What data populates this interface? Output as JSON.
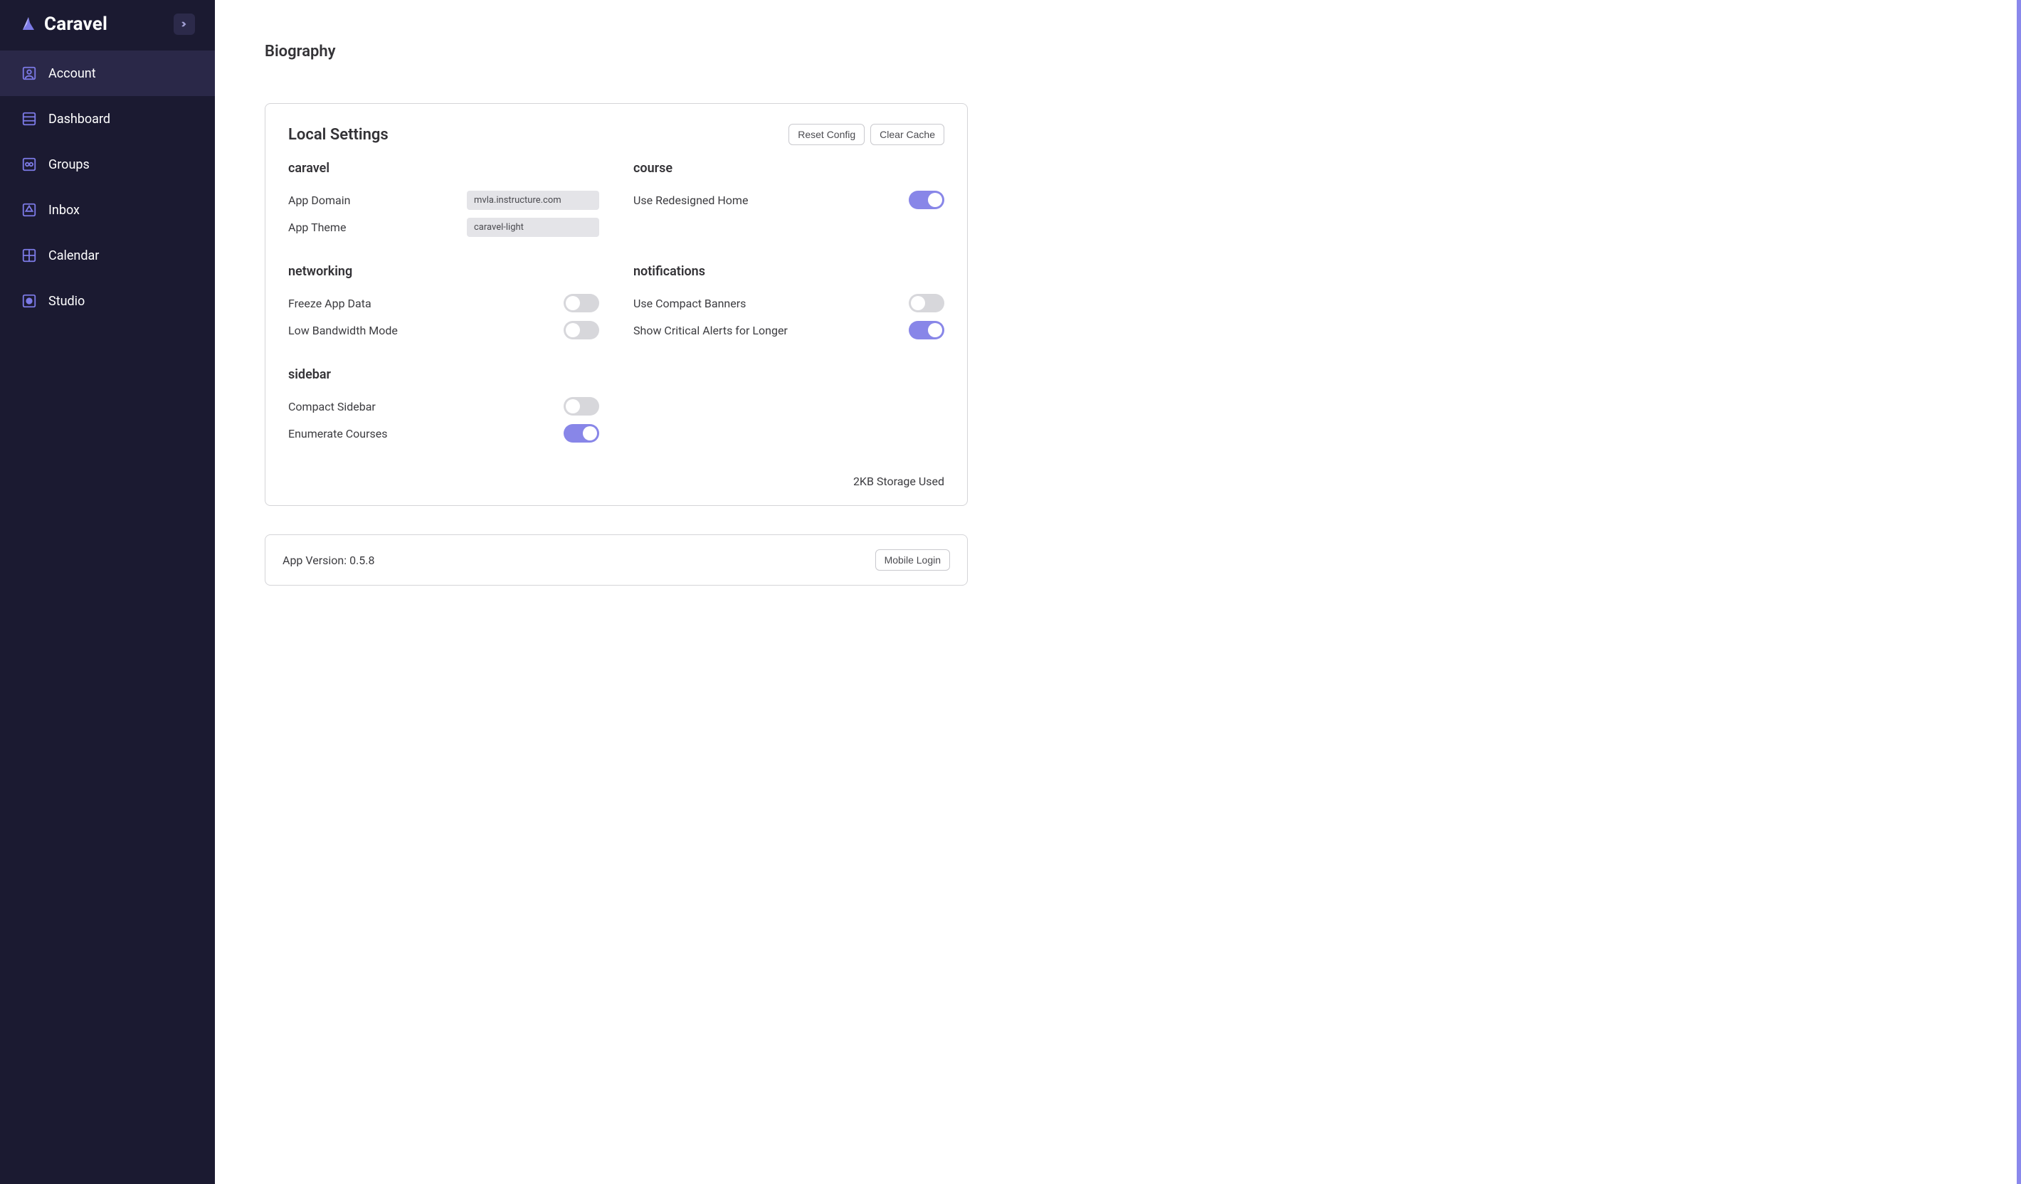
{
  "brand": {
    "name": "Caravel"
  },
  "sidebar": {
    "items": [
      {
        "label": "Account",
        "icon": "account",
        "active": true
      },
      {
        "label": "Dashboard",
        "icon": "dashboard",
        "active": false
      },
      {
        "label": "Groups",
        "icon": "groups",
        "active": false
      },
      {
        "label": "Inbox",
        "icon": "inbox",
        "active": false
      },
      {
        "label": "Calendar",
        "icon": "calendar",
        "active": false
      },
      {
        "label": "Studio",
        "icon": "studio",
        "active": false
      }
    ]
  },
  "page": {
    "biography_heading": "Biography",
    "local_settings": {
      "title": "Local Settings",
      "reset_label": "Reset Config",
      "clear_label": "Clear Cache",
      "caravel": {
        "heading": "caravel",
        "app_domain_label": "App Domain",
        "app_domain_value": "mvla.instructure.com",
        "app_theme_label": "App Theme",
        "app_theme_value": "caravel-light"
      },
      "course": {
        "heading": "course",
        "redesigned_home_label": "Use Redesigned Home",
        "redesigned_home_on": true
      },
      "networking": {
        "heading": "networking",
        "freeze_label": "Freeze App Data",
        "freeze_on": false,
        "low_bw_label": "Low Bandwidth Mode",
        "low_bw_on": false
      },
      "notifications": {
        "heading": "notifications",
        "compact_banners_label": "Use Compact Banners",
        "compact_banners_on": false,
        "critical_longer_label": "Show Critical Alerts for Longer",
        "critical_longer_on": true
      },
      "sidebar_group": {
        "heading": "sidebar",
        "compact_label": "Compact Sidebar",
        "compact_on": false,
        "enumerate_label": "Enumerate Courses",
        "enumerate_on": true
      },
      "storage_text": "2KB Storage Used"
    },
    "version": {
      "text": "App Version: 0.5.8",
      "mobile_login_label": "Mobile Login"
    }
  },
  "colors": {
    "sidebar_bg": "#1b1a31",
    "sidebar_active": "#2a2848",
    "accent": "#8886e8",
    "icon": "#7c7ae6"
  }
}
